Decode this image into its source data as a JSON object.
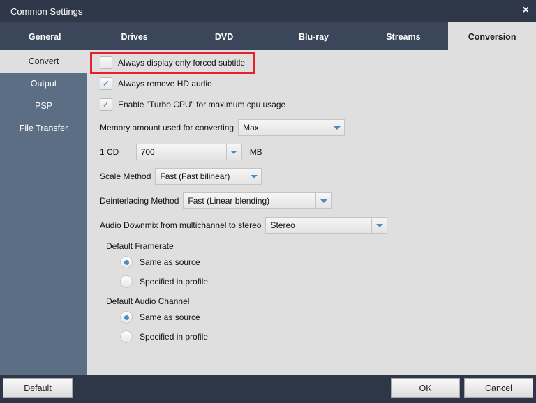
{
  "window": {
    "title": "Common Settings",
    "close_icon": "×"
  },
  "tabs": [
    "General",
    "Drives",
    "DVD",
    "Blu-ray",
    "Streams",
    "Conversion"
  ],
  "sidebar": [
    "Convert",
    "Output",
    "PSP",
    "File Transfer"
  ],
  "options": {
    "forced_subtitle": {
      "label": "Always display only forced subtitle",
      "checked": false
    },
    "remove_hd_audio": {
      "label": "Always remove HD audio",
      "checked": true
    },
    "turbo_cpu": {
      "label": "Enable \"Turbo CPU\" for maximum cpu usage",
      "checked": true
    }
  },
  "memory": {
    "label": "Memory amount used for converting",
    "value": "Max"
  },
  "cd": {
    "label": "1 CD =",
    "value": "700",
    "unit": "MB"
  },
  "scale": {
    "label": "Scale Method",
    "value": "Fast (Fast bilinear)"
  },
  "deinterlace": {
    "label": "Deinterlacing Method",
    "value": "Fast (Linear blending)"
  },
  "downmix": {
    "label": "Audio Downmix from multichannel to stereo",
    "value": "Stereo"
  },
  "framerate": {
    "label": "Default Framerate",
    "options": [
      "Same as source",
      "Specified in profile"
    ],
    "selected": 0
  },
  "audio_channel": {
    "label": "Default Audio Channel",
    "options": [
      "Same as source",
      "Specified in profile"
    ],
    "selected": 0
  },
  "footer": {
    "default": "Default",
    "ok": "OK",
    "cancel": "Cancel"
  }
}
